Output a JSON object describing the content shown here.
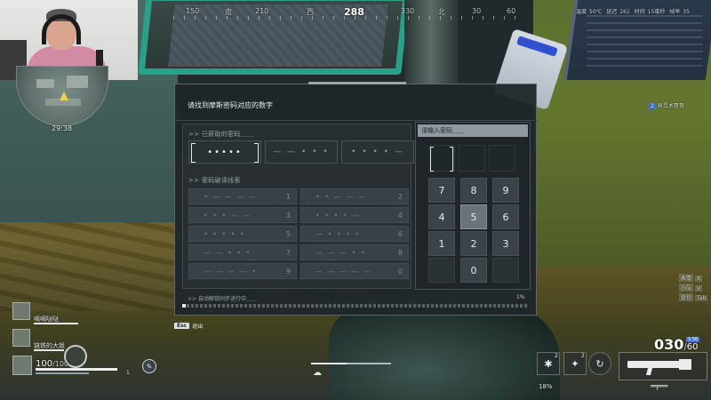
{
  "hud": {
    "compass": {
      "heading": "288",
      "marks": [
        "150",
        "南",
        "210",
        "西",
        "330",
        "北",
        "30",
        "60"
      ]
    },
    "status": {
      "temp_label": "温度",
      "temp_value": "50℃",
      "ping_label": "延迟",
      "ping_value": "261",
      "time_label": "时间",
      "time_value": "15毫秒",
      "fps_label": "帧率",
      "fps_value": "35"
    },
    "match_timer": "29:38",
    "teammate_tag": {
      "number": "2",
      "name": "异灵术哥哥"
    },
    "squad": [
      {
        "name": "嘀嘀哒哒"
      },
      {
        "name": "链铁的大姐"
      }
    ],
    "player": {
      "hp": "100",
      "hp_max": "100"
    },
    "ability_label": "1",
    "esc_hint": {
      "key": "Esc",
      "label": "退出"
    },
    "side_labels": [
      {
        "label": "表情",
        "key": "X"
      },
      {
        "label": "小队",
        "key": "V"
      },
      {
        "label": "背包",
        "key": "Tab"
      }
    ],
    "ammo": {
      "magazine": "030",
      "reserve": "60",
      "tag": "5.56"
    },
    "equipment": [
      {
        "icon": "grenade-icon",
        "glyph": "✱",
        "count": "2"
      },
      {
        "icon": "smoke-icon",
        "glyph": "✦",
        "count": "2"
      },
      {
        "icon": "ability-icon",
        "glyph": "↻",
        "count": ""
      }
    ],
    "durability": "18%"
  },
  "puzzle": {
    "title": "请找到摩斯密码对应的数字",
    "obtained_label": ">> 已获取的密码＿＿",
    "codes": [
      {
        "text": "•••••",
        "active": true
      },
      {
        "text": "— — • • •",
        "active": false
      },
      {
        "text": "• • • • —",
        "active": false
      }
    ],
    "clues_label": ">> 密码破译线索",
    "clues": [
      {
        "code": "• — — — —",
        "digit": "1"
      },
      {
        "code": "• • — — —",
        "digit": "2"
      },
      {
        "code": "• • • — —",
        "digit": "3"
      },
      {
        "code": "• • • • —",
        "digit": "4"
      },
      {
        "code": "• • • • •",
        "digit": "5"
      },
      {
        "code": "— • • • •",
        "digit": "6"
      },
      {
        "code": "— — • • •",
        "digit": "7"
      },
      {
        "code": "— — — • •",
        "digit": "8"
      },
      {
        "code": "— — — — •",
        "digit": "9"
      },
      {
        "code": "— — — — —",
        "digit": "0"
      }
    ],
    "progress_label": ">> 自动解锁同步进行中＿＿",
    "progress_pct_text": "1%",
    "progress_value": 0.01,
    "input_placeholder": "请输入密码＿＿",
    "keys": [
      "7",
      "8",
      "9",
      "4",
      "5",
      "6",
      "1",
      "2",
      "3",
      "",
      "0",
      ""
    ],
    "hovered_key": "5"
  },
  "colors": {
    "panel_bg": "#20262a",
    "accent_window": "#2aa088",
    "ammo_tag": "#4a72d8"
  }
}
